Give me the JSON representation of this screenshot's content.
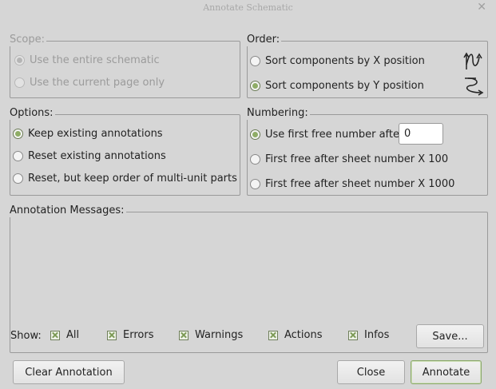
{
  "window": {
    "title": "Annotate Schematic",
    "close_glyph": "✕"
  },
  "scope": {
    "legend": "Scope:",
    "options": [
      {
        "label": "Use the entire schematic",
        "selected": true
      },
      {
        "label": "Use the current page only",
        "selected": false
      }
    ],
    "enabled": false
  },
  "order": {
    "legend": "Order:",
    "options": [
      {
        "label": "Sort components by X position",
        "selected": false,
        "icon": "sort-x-icon"
      },
      {
        "label": "Sort components by Y position",
        "selected": true,
        "icon": "sort-y-icon"
      }
    ]
  },
  "options": {
    "legend": "Options:",
    "items": [
      {
        "label": "Keep existing annotations",
        "selected": true
      },
      {
        "label": "Reset existing annotations",
        "selected": false
      },
      {
        "label": "Reset, but keep order of multi-unit parts",
        "selected": false
      }
    ]
  },
  "numbering": {
    "legend": "Numbering:",
    "items": [
      {
        "label": "Use first free number after:",
        "selected": true
      },
      {
        "label": "First free after sheet number X 100",
        "selected": false
      },
      {
        "label": "First free after sheet number X 1000",
        "selected": false
      }
    ],
    "first_free_value": "0"
  },
  "messages": {
    "legend": "Annotation Messages:",
    "show_label": "Show:",
    "filters": [
      {
        "label": "All",
        "checked": true
      },
      {
        "label": "Errors",
        "checked": true
      },
      {
        "label": "Warnings",
        "checked": true
      },
      {
        "label": "Actions",
        "checked": true
      },
      {
        "label": "Infos",
        "checked": true
      }
    ],
    "save_label": "Save..."
  },
  "buttons": {
    "clear": "Clear Annotation",
    "close": "Close",
    "annotate": "Annotate"
  },
  "colors": {
    "background": "#d6d6d6",
    "accent": "#8fad66",
    "disabled_text": "#9b9b9b"
  }
}
